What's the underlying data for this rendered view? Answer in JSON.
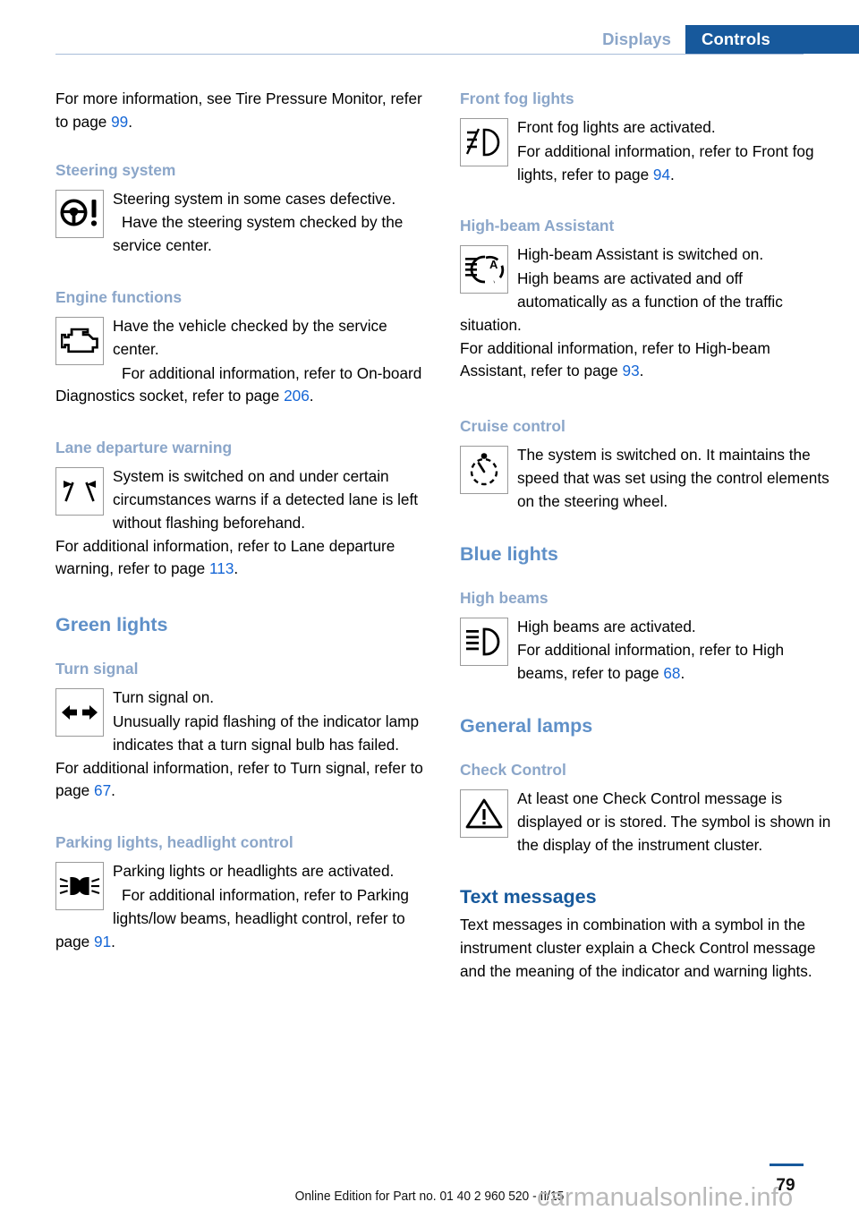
{
  "header": {
    "tabs": [
      {
        "label": "Displays",
        "active": false
      },
      {
        "label": "Controls",
        "active": true
      }
    ],
    "accent_active_bg": "#17599c",
    "accent_inactive_text": "#8ba6c9"
  },
  "left_column": {
    "intro": {
      "text_before": "For more information, see Tire Pressure Monitor, refer to page ",
      "page_link": "99",
      "text_after": "."
    },
    "steering": {
      "heading": "Steering system",
      "icon": "steering-wheel-warning-icon",
      "line1": "Steering system in some cases defective.",
      "line2": "Have the steering system checked by the service center."
    },
    "engine": {
      "heading": "Engine functions",
      "icon": "engine-check-icon",
      "line1": "Have the vehicle checked by the service center.",
      "line2_before": "For additional information, refer to On-board Diagnostics socket, refer to page ",
      "page_link": "206",
      "line2_after": "."
    },
    "lane": {
      "heading": "Lane departure warning",
      "icon": "lane-departure-warning-icon",
      "line1": "System is switched on and under certain circumstances warns if a detected lane is left without flashing beforehand.",
      "line2_before": "For additional information, refer to Lane departure warning, refer to page ",
      "page_link": "113",
      "line2_after": "."
    },
    "green_lights_heading": "Green lights",
    "turn_signal": {
      "heading": "Turn signal",
      "icon": "turn-signal-arrows-icon",
      "line1": "Turn signal on.",
      "line2": "Unusually rapid flashing of the indicator lamp indicates that a turn signal bulb has failed.",
      "line3_before": "For additional information, refer to Turn signal, refer to page ",
      "page_link": "67",
      "line3_after": "."
    },
    "parking_lights": {
      "heading": "Parking lights, headlight control",
      "icon": "parking-lights-icon",
      "line1": "Parking lights or headlights are activated.",
      "line2_before": "For additional information, refer to Parking lights/low beams, headlight control, refer to page ",
      "page_link": "91",
      "line2_after": "."
    }
  },
  "right_column": {
    "front_fog": {
      "heading": "Front fog lights",
      "icon": "front-fog-light-icon",
      "line1": "Front fog lights are activated.",
      "line2_before": "For additional information, refer to Front fog lights, refer to page ",
      "page_link": "94",
      "line2_after": "."
    },
    "high_beam_assistant": {
      "heading": "High-beam Assistant",
      "icon": "high-beam-assistant-icon",
      "line1": "High-beam Assistant is switched on.",
      "line2": "High beams are activated and off automatically as a function of the traffic situation.",
      "line3_before": "For additional information, refer to High-beam Assistant, refer to page ",
      "page_link": "93",
      "line3_after": "."
    },
    "cruise_control": {
      "heading": "Cruise control",
      "icon": "cruise-control-gauge-icon",
      "line1": "The system is switched on. It maintains the speed that was set using the control elements on the steering wheel."
    },
    "blue_lights_heading": "Blue lights",
    "high_beams": {
      "heading": "High beams",
      "icon": "high-beam-icon",
      "line1": "High beams are activated.",
      "line2_before": "For additional information, refer to High beams, refer to page ",
      "page_link": "68",
      "line2_after": "."
    },
    "general_lamps_heading": "General lamps",
    "check_control": {
      "heading": "Check Control",
      "icon": "warning-triangle-icon",
      "line1": "At least one Check Control message is displayed or is stored. The symbol is shown in the display of the instrument cluster."
    },
    "text_messages": {
      "heading": "Text messages",
      "body": "Text messages in combination with a symbol in the instrument cluster explain a Check Control message and the meaning of the indicator and warning lights."
    }
  },
  "footer": {
    "page_number": "79",
    "edition": "Online Edition for Part no. 01 40 2 960 520 - II/15",
    "watermark": "carmanualsonline.info"
  }
}
